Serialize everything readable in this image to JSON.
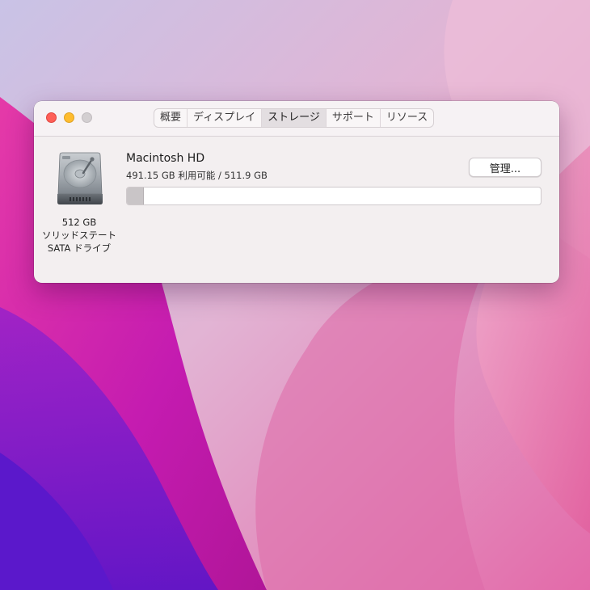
{
  "colors": {
    "desktop_pink": "#e89ac0",
    "desktop_magenta": "#c81fa8",
    "desktop_purple": "#6a1fc8",
    "window_bg": "#f3eff0",
    "traffic_close": "#fe5f57",
    "traffic_minimize": "#febc2e",
    "traffic_zoom_inactive": "#d3cfd1"
  },
  "window": {
    "traffic_lights": [
      "close",
      "minimize",
      "zoom"
    ],
    "tabs": [
      {
        "label": "概要",
        "active": false
      },
      {
        "label": "ディスプレイ",
        "active": false
      },
      {
        "label": "ストレージ",
        "active": true
      },
      {
        "label": "サポート",
        "active": false
      },
      {
        "label": "リソース",
        "active": false
      }
    ]
  },
  "storage": {
    "disk": {
      "icon": "hard-drive-icon",
      "capacity": "512 GB",
      "type_line1": "ソリッドステート",
      "type_line2": "SATA ドライブ"
    },
    "volume": {
      "name": "Macintosh HD",
      "space": "491.15 GB 利用可能 / 511.9 GB",
      "used_fraction": 0.04
    },
    "manage_button": "管理..."
  }
}
